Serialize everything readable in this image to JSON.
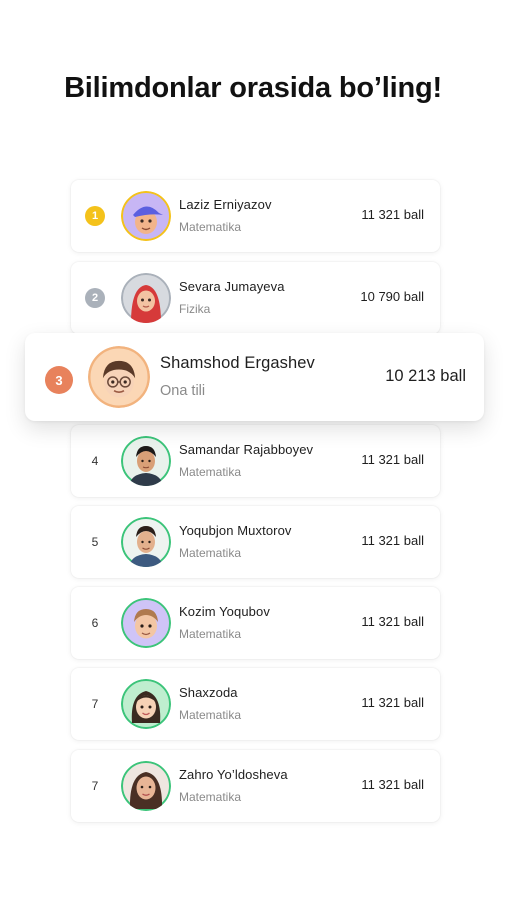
{
  "headline": "Bilimdonlar orasida bo’ling!",
  "leaderboard": [
    {
      "rank": "1",
      "name": "Laziz Erniyazov",
      "subject": "Matematika",
      "score": "11 321 ball",
      "ring": "#f4c21b"
    },
    {
      "rank": "2",
      "name": "Sevara Jumayeva",
      "subject": "Fizika",
      "score": "10 790 ball",
      "ring": "#aab1ba"
    },
    {
      "rank": "3",
      "name": "Shamshod Ergashev",
      "subject": "Ona tili",
      "score": "10 213 ball",
      "ring": "#e8825c"
    },
    {
      "rank": "4",
      "name": "Samandar Rajabboyev",
      "subject": "Matematika",
      "score": "11 321 ball",
      "ring": "#3cc47a"
    },
    {
      "rank": "5",
      "name": "Yoqubjon Muxtorov",
      "subject": "Matematika",
      "score": "11 321 ball",
      "ring": "#3cc47a"
    },
    {
      "rank": "6",
      "name": "Kozim Yoqubov",
      "subject": "Matematika",
      "score": "11 321 ball",
      "ring": "#3cc47a"
    },
    {
      "rank": "7",
      "name": "Shaxzoda",
      "subject": "Matematika",
      "score": "11 321 ball",
      "ring": "#3cc47a"
    },
    {
      "rank": "7",
      "name": "Zahro Yo’ldosheva",
      "subject": "Matematika",
      "score": "11 321 ball",
      "ring": "#3cc47a"
    }
  ]
}
